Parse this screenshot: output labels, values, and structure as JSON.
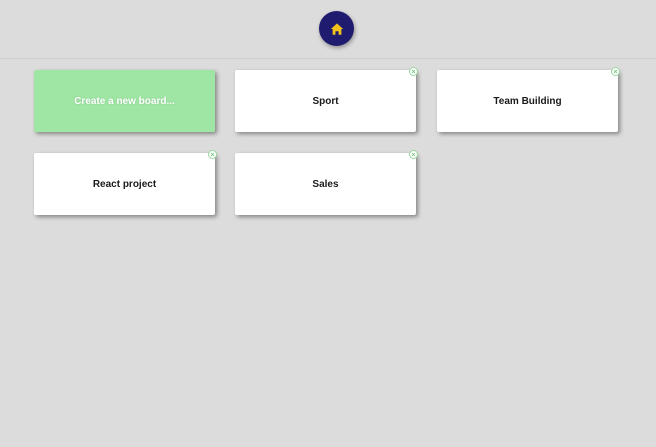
{
  "header": {
    "home_icon": "home-icon",
    "home_color": "#1f1b6e",
    "home_icon_color": "#f2c21b"
  },
  "create_tile": {
    "label": "Create a new board...",
    "color": "#9fe6a5"
  },
  "boards": [
    {
      "label": "Sport"
    },
    {
      "label": "Team Building"
    },
    {
      "label": "React project"
    },
    {
      "label": "Sales"
    }
  ],
  "delete_icon": "close-circle-icon"
}
